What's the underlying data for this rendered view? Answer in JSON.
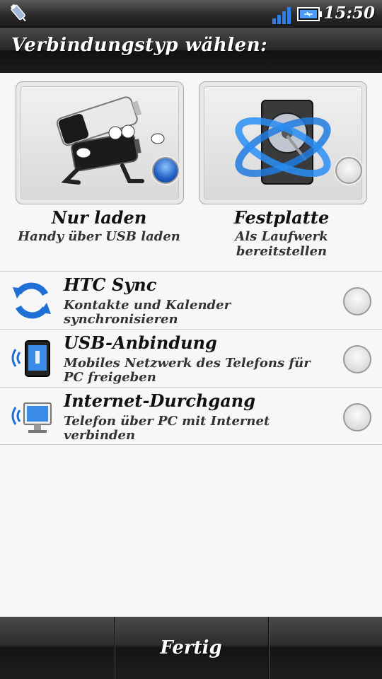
{
  "status_bar": {
    "time": "15:50",
    "icons": [
      "usb-icon",
      "signal-icon",
      "battery-icon"
    ]
  },
  "header": {
    "title": "Verbindungstyp wählen:"
  },
  "cards": [
    {
      "title": "Nur laden",
      "subtitle": "Handy über USB laden",
      "icon": "battery-character-icon",
      "selected": true
    },
    {
      "title": "Festplatte",
      "subtitle": "Als Laufwerk bereitstellen",
      "icon": "hard-disk-icon",
      "selected": false
    }
  ],
  "list": [
    {
      "title": "HTC Sync",
      "subtitle": "Kontakte und Kalender synchronisieren",
      "icon": "sync-icon",
      "selected": false
    },
    {
      "title": "USB-Anbindung",
      "subtitle": "Mobiles Netzwerk des Telefons für PC freigeben",
      "icon": "phone-wireless-icon",
      "selected": false
    },
    {
      "title": "Internet-Durchgang",
      "subtitle": "Telefon über PC mit Internet verbinden",
      "icon": "monitor-wireless-icon",
      "selected": false
    }
  ],
  "bottom_bar": {
    "done_label": "Fertig"
  },
  "colors": {
    "accent_blue": "#1f5fc2",
    "bar_dark": "#1c1c1c"
  }
}
